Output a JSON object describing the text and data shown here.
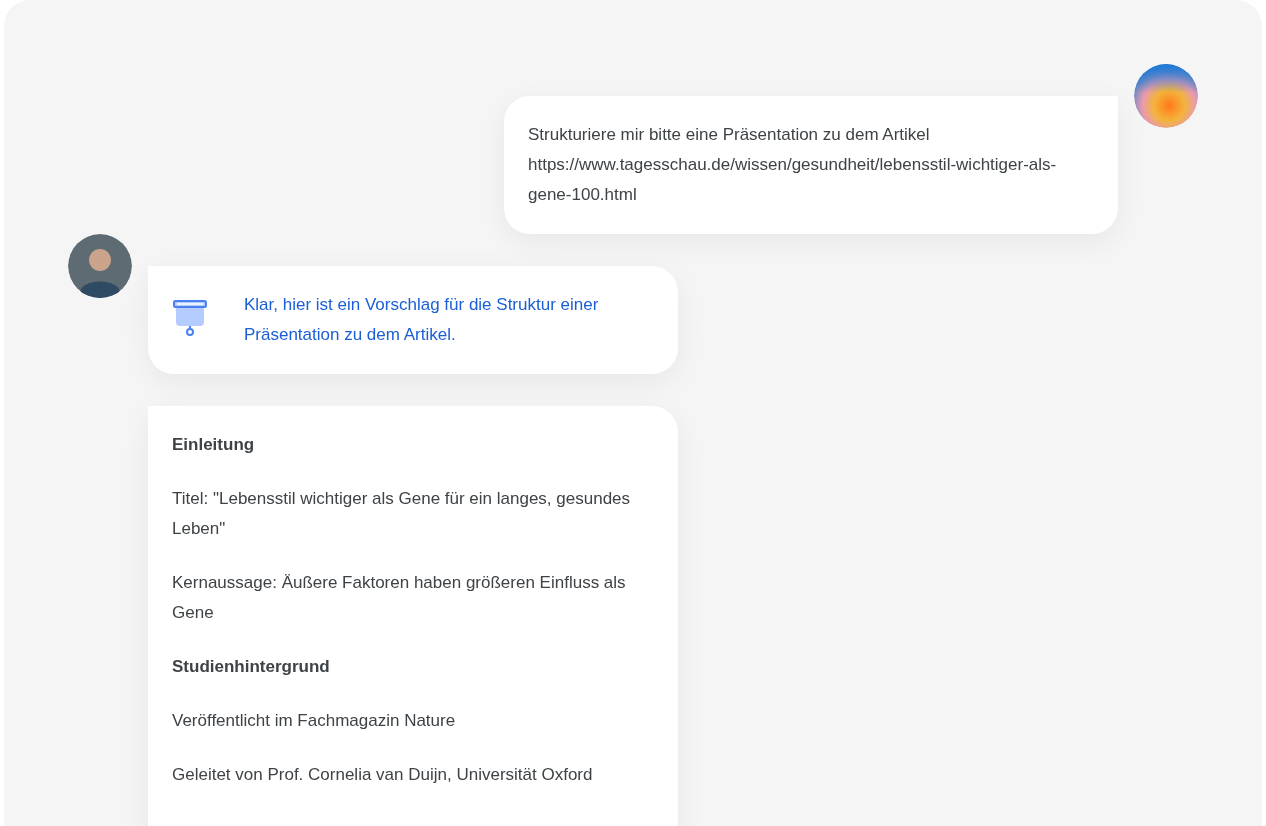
{
  "messages": [
    {
      "kind": "user",
      "text": "Strukturiere mir bitte eine Präsentation zu dem Artikel https://www.tagesschau.de/wissen/gesundheit/lebensstil-wichtiger-als-gene-100.html"
    },
    {
      "kind": "assistant",
      "text": "Klar, hier ist ein Vorschlag für die Struktur einer Präsentation zu dem Artikel."
    },
    {
      "kind": "outline",
      "blocks": [
        {
          "kind": "heading",
          "text": "Einleitung"
        },
        {
          "kind": "paragraph",
          "text": "Titel: \"Lebensstil wichtiger als Gene für ein langes, gesundes Leben\""
        },
        {
          "kind": "paragraph",
          "text": "Kernaussage: Äußere Faktoren haben größeren Einfluss als Gene"
        },
        {
          "kind": "heading",
          "text": "Studienhintergrund"
        },
        {
          "kind": "paragraph",
          "text": "Veröffentlicht im Fachmagazin Nature"
        },
        {
          "kind": "paragraph",
          "text": "Geleitet von Prof. Cornelia van Duijn, Universität Oxford"
        }
      ]
    }
  ]
}
